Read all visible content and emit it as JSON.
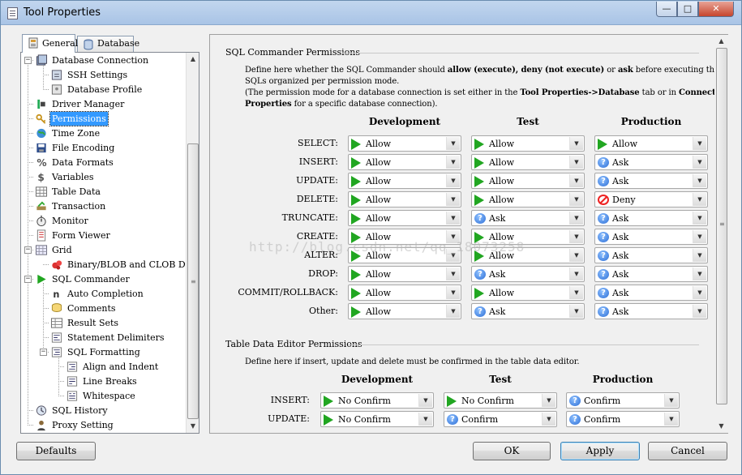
{
  "window": {
    "title": "Tool Properties",
    "min": "—",
    "max": "□",
    "close": "✕"
  },
  "tabs": [
    {
      "label": "General"
    },
    {
      "label": "Database"
    }
  ],
  "tree": [
    {
      "label": "Database Connection",
      "icon": "database-connection-icon"
    },
    {
      "label": "SSH Settings",
      "icon": "ssh-icon"
    },
    {
      "label": "Database Profile",
      "icon": "profile-icon"
    },
    {
      "label": "Driver Manager",
      "icon": "driver-icon"
    },
    {
      "label": "Permissions",
      "icon": "key-icon"
    },
    {
      "label": "Time Zone",
      "icon": "globe-icon"
    },
    {
      "label": "File Encoding",
      "icon": "floppy-icon"
    },
    {
      "label": "Data Formats",
      "icon": "percent-icon"
    },
    {
      "label": "Variables",
      "icon": "dollar-icon"
    },
    {
      "label": "Table Data",
      "icon": "table-icon"
    },
    {
      "label": "Transaction",
      "icon": "transaction-icon"
    },
    {
      "label": "Monitor",
      "icon": "stopwatch-icon"
    },
    {
      "label": "Form Viewer",
      "icon": "form-icon"
    },
    {
      "label": "Grid",
      "icon": "grid-icon"
    },
    {
      "label": "Binary/BLOB and CLOB Data",
      "icon": "blob-icon"
    },
    {
      "label": "SQL Commander",
      "icon": "play-icon"
    },
    {
      "label": "Auto Completion",
      "icon": "auto-completion-icon"
    },
    {
      "label": "Comments",
      "icon": "comments-icon"
    },
    {
      "label": "Result Sets",
      "icon": "result-sets-icon"
    },
    {
      "label": "Statement Delimiters",
      "icon": "delimiters-icon"
    },
    {
      "label": "SQL Formatting",
      "icon": "formatting-icon"
    },
    {
      "label": "Align and Indent",
      "icon": "align-icon"
    },
    {
      "label": "Line Breaks",
      "icon": "line-breaks-icon"
    },
    {
      "label": "Whitespace",
      "icon": "whitespace-icon"
    },
    {
      "label": "SQL History",
      "icon": "history-icon"
    },
    {
      "label": "Proxy Setting",
      "icon": "proxy-icon"
    }
  ],
  "sql_permissions": {
    "title": "SQL Commander Permissions",
    "desc1a": "Define here whether the SQL Commander should ",
    "desc1b": "allow (execute), deny (not execute)",
    "desc1c": " or ",
    "desc1d": "ask",
    "desc1e": " before executing the following",
    "desc2": "SQLs organized per permission mode.",
    "desc3a": "(The permission mode for a database connection is set either in the ",
    "desc3b": "Tool Properties->Database",
    "desc3c": " tab or in ",
    "desc3d": "Connection",
    "desc4a": "Properties",
    "desc4b": " for a specific database connection).",
    "columns": [
      "Development",
      "Test",
      "Production"
    ],
    "rows": [
      {
        "label": "SELECT:",
        "values": [
          "Allow",
          "Allow",
          "Allow"
        ]
      },
      {
        "label": "INSERT:",
        "values": [
          "Allow",
          "Allow",
          "Ask"
        ]
      },
      {
        "label": "UPDATE:",
        "values": [
          "Allow",
          "Allow",
          "Ask"
        ]
      },
      {
        "label": "DELETE:",
        "values": [
          "Allow",
          "Allow",
          "Deny"
        ]
      },
      {
        "label": "TRUNCATE:",
        "values": [
          "Allow",
          "Ask",
          "Ask"
        ]
      },
      {
        "label": "CREATE:",
        "values": [
          "Allow",
          "Allow",
          "Ask"
        ]
      },
      {
        "label": "ALTER:",
        "values": [
          "Allow",
          "Allow",
          "Ask"
        ]
      },
      {
        "label": "DROP:",
        "values": [
          "Allow",
          "Ask",
          "Ask"
        ]
      },
      {
        "label": "COMMIT/ROLLBACK:",
        "values": [
          "Allow",
          "Allow",
          "Ask"
        ]
      },
      {
        "label": "Other:",
        "values": [
          "Allow",
          "Ask",
          "Ask"
        ]
      }
    ]
  },
  "table_editor": {
    "title": "Table Data Editor Permissions",
    "desc": "Define here if insert, update and delete must be confirmed in the table data editor.",
    "columns": [
      "Development",
      "Test",
      "Production"
    ],
    "rows": [
      {
        "label": "INSERT:",
        "values": [
          "No Confirm",
          "No Confirm",
          "Confirm"
        ]
      },
      {
        "label": "UPDATE:",
        "values": [
          "No Confirm",
          "Confirm",
          "Confirm"
        ]
      }
    ]
  },
  "watermark": "http://blog.csdn.net/qq_18073258",
  "buttons": {
    "defaults": "Defaults",
    "ok": "OK",
    "apply": "Apply",
    "cancel": "Cancel"
  },
  "colors": {
    "allow": "#21a621",
    "ask": "#2d6ed6",
    "deny": "#e22222",
    "selection": "#3399ff"
  }
}
